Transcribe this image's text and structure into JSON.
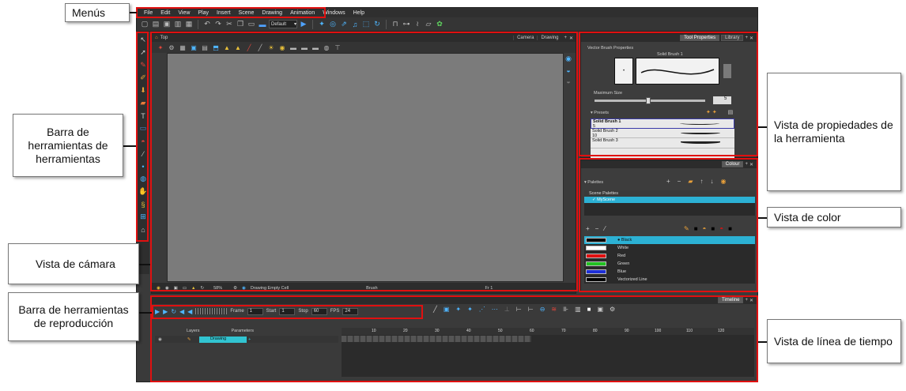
{
  "menubar": {
    "items": [
      "File",
      "Edit",
      "View",
      "Play",
      "Insert",
      "Scene",
      "Drawing",
      "Animation",
      "Windows",
      "Help"
    ]
  },
  "toolbar": {
    "workspace_select": "Default"
  },
  "camera": {
    "breadcrumb": "Top",
    "tabs": [
      "Camera",
      "Drawing"
    ],
    "zoom": "58%",
    "status_drawing": "Drawing Empty Cell",
    "status_tool": "Brush",
    "status_frame": "Fr 1"
  },
  "tool_properties": {
    "tabs": [
      "Tool Properties",
      "Library"
    ],
    "section_title": "Vector Brush Properties",
    "brush_name": "Solid Brush 1",
    "max_size_label": "Maximum Size",
    "max_size_value": "5",
    "presets_label": "Presets",
    "presets": [
      {
        "name": "Solid Brush 1",
        "size": "5"
      },
      {
        "name": "Solid Brush 2",
        "size": "10"
      },
      {
        "name": "Solid Brush 3",
        "size": ""
      }
    ]
  },
  "colour": {
    "tab": "Colour",
    "palettes_label": "Palettes",
    "scene_palettes_label": "Scene Palettes",
    "palette_selected": "MyScene",
    "colours": [
      {
        "name": "Black",
        "hex": "#000000"
      },
      {
        "name": "White",
        "hex": "#ffffff"
      },
      {
        "name": "Red",
        "hex": "#e01010"
      },
      {
        "name": "Green",
        "hex": "#22c322"
      },
      {
        "name": "Blue",
        "hex": "#1d2fd6"
      },
      {
        "name": "Vectorized Line",
        "hex": "#000000"
      }
    ]
  },
  "timeline": {
    "tab": "Timeline",
    "frame_label": "Frame",
    "frame_value": "1",
    "start_label": "Start",
    "start_value": "1",
    "stop_label": "Stop",
    "stop_value": "60",
    "fps_label": "FPS",
    "fps_value": "24",
    "layers_header": "Layers",
    "parameters_header": "Parameters",
    "layer_name": "Drawing",
    "ruler_ticks": [
      "10",
      "20",
      "30",
      "40",
      "50",
      "60",
      "70",
      "80",
      "90",
      "100",
      "110",
      "120"
    ]
  },
  "callouts": {
    "menus": "Menús",
    "tools_toolbar": "Barra de herramientas de herramientas",
    "camera_view": "Vista de cámara",
    "playback_toolbar": "Barra de herramientas de reproducción",
    "tool_properties_view": "Vista de propiedades de la herramienta",
    "colour_view": "Vista de color",
    "timeline_view": "Vista de línea de tiempo"
  },
  "colors": {
    "annotation_outline": "#e01010",
    "selection_cyan": "#2cb1d4",
    "canvas_gray": "#7b7b7b"
  }
}
